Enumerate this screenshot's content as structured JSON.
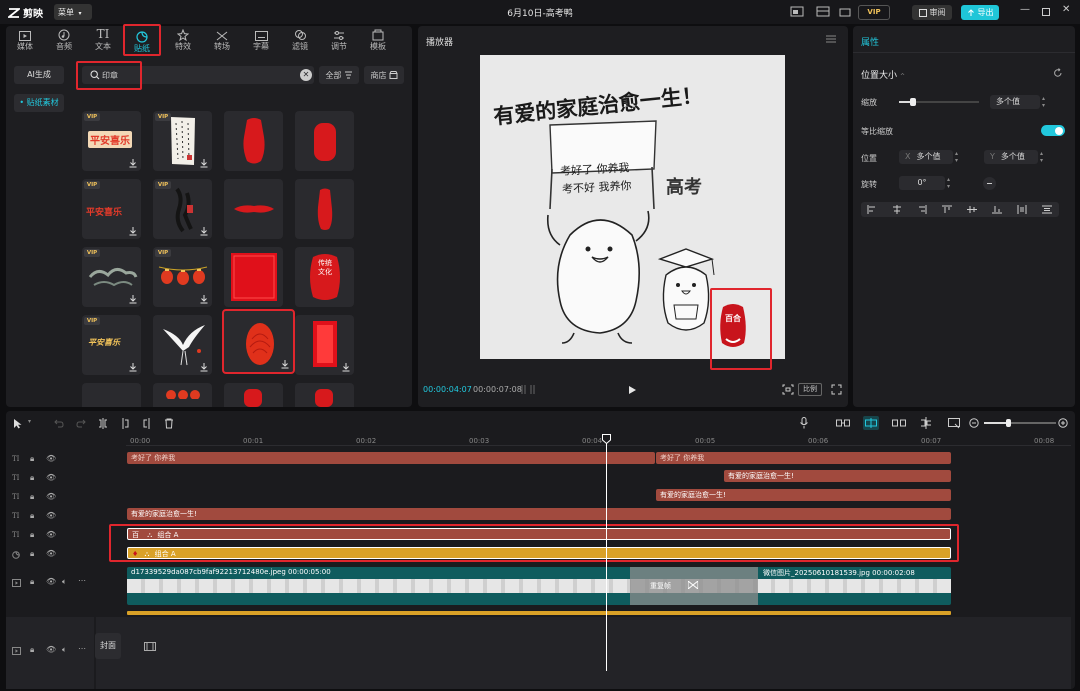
{
  "app": {
    "name": "剪映",
    "menu_label": "菜单",
    "project_title": "6月10日-高考鸭",
    "vip_label": "VIP",
    "review_label": "审阅",
    "export_label": "导出"
  },
  "categories": [
    {
      "label": "媒体",
      "icon": "media-icon"
    },
    {
      "label": "音频",
      "icon": "audio-icon"
    },
    {
      "label": "文本",
      "icon": "text-icon"
    },
    {
      "label": "贴纸",
      "icon": "sticker-icon"
    },
    {
      "label": "特效",
      "icon": "effects-icon"
    },
    {
      "label": "转场",
      "icon": "transition-icon"
    },
    {
      "label": "字幕",
      "icon": "subtitle-icon"
    },
    {
      "label": "滤镜",
      "icon": "filter-icon"
    },
    {
      "label": "调节",
      "icon": "adjust-icon"
    },
    {
      "label": "模板",
      "icon": "template-icon"
    }
  ],
  "left_sidebar": {
    "ai_label": "AI生成",
    "material_label": "• 贴纸素材"
  },
  "search": {
    "value": "印章",
    "all_label": "全部",
    "shop_label": "商店"
  },
  "stickers": {
    "vip_tag": "VIP",
    "texts": [
      "平安喜乐",
      "平安喜乐",
      "传统文化",
      "平安喜乐"
    ],
    "stamp_text": "百合"
  },
  "player": {
    "title": "播放器",
    "canvas_title": "有爱的家庭治愈一生！",
    "banner_line1": "考好了 你养我",
    "banner_line2": "考不好 我养你",
    "side_text": "高考",
    "stamp_text": "百合",
    "time_current": "00:00:04:07",
    "time_total": "00:00:07:08",
    "ratio_label": "比例"
  },
  "properties": {
    "title": "属性",
    "section": "位置大小",
    "scale_label": "缩放",
    "scale_value": "多个值",
    "scale_level": 0.18,
    "uniform_label": "等比缩放",
    "position_label": "位置",
    "x_axis": "X",
    "x_value": "多个值",
    "y_axis": "Y",
    "y_value": "多个值",
    "rotation_label": "旋转",
    "rotation_value": "0°"
  },
  "timeline": {
    "ruler": [
      "00:00",
      "00:01",
      "00:02",
      "00:03",
      "00:04",
      "00:05",
      "00:06",
      "00:07",
      "00:08"
    ],
    "text_clip_a": "考好了 你养我",
    "text_clip_b": "考好了 你养我",
    "text_clip_c": "有爱的家庭治愈一生!",
    "text_clip_d": "有爱的家庭治愈一生!",
    "text_clip_e": "有爱的家庭治愈一生!",
    "group_prefix": "百",
    "group_label": "组合 A",
    "video_clip_1": "d17339529da087cb9faf92213712480e.jpeg  00:00:05:00",
    "video_clip_2": "微信图片_20250610181539.jpg  00:00:02:08",
    "repeat_label": "重复帧",
    "cover_label": "封面"
  }
}
